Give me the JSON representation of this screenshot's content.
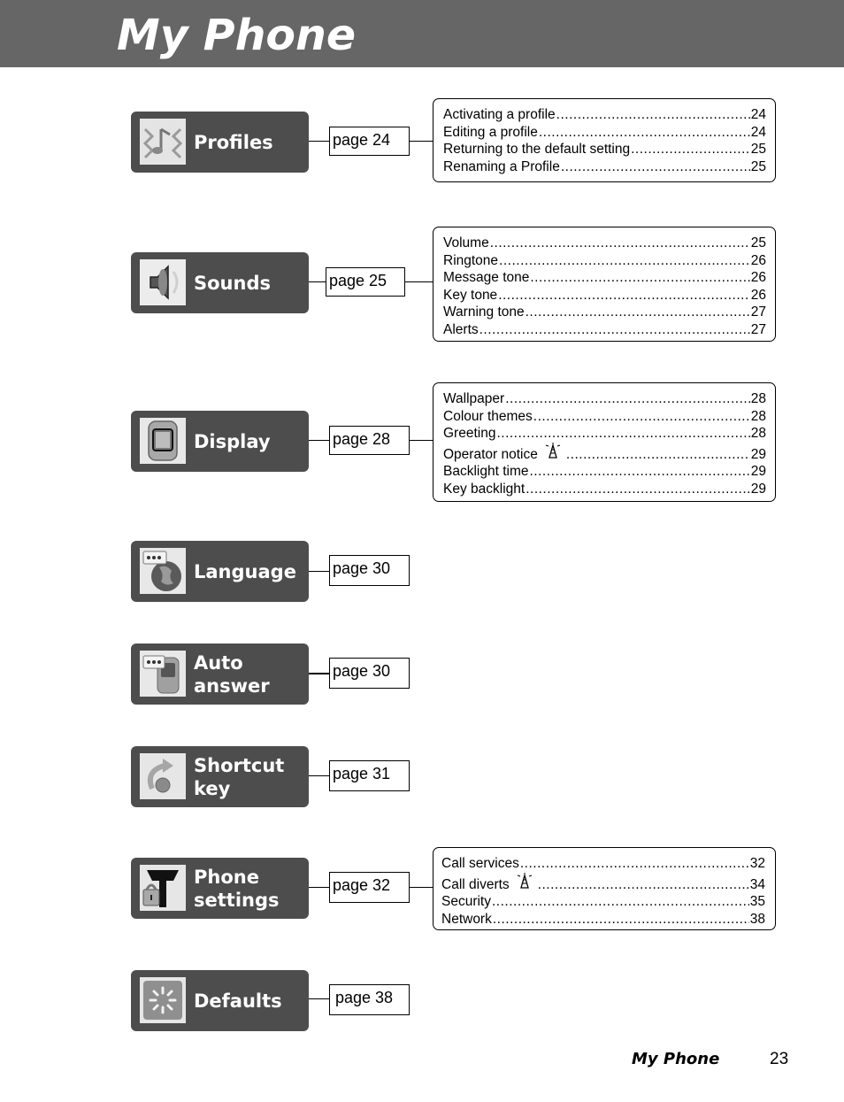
{
  "header": {
    "title": "My Phone"
  },
  "sections": [
    {
      "label": "Profiles",
      "icon": "profiles-icon",
      "page_ref": "page 24",
      "toc": [
        {
          "text": "Activating a profile",
          "page": "24"
        },
        {
          "text": "Editing a profile",
          "page": "24"
        },
        {
          "text": "Returning to the default setting",
          "page": "25"
        },
        {
          "text": "Renaming a Profile",
          "page": "25"
        }
      ]
    },
    {
      "label": "Sounds",
      "icon": "speaker-icon",
      "page_ref": "page 25",
      "toc": [
        {
          "text": "Volume",
          "page": "25"
        },
        {
          "text": "Ringtone",
          "page": "26"
        },
        {
          "text": "Message tone",
          "page": "26"
        },
        {
          "text": "Key tone",
          "page": "26"
        },
        {
          "text": "Warning tone",
          "page": "27"
        },
        {
          "text": "Alerts",
          "page": "27"
        }
      ]
    },
    {
      "label": "Display",
      "icon": "display-icon",
      "page_ref": "page 28",
      "toc": [
        {
          "text": "Wallpaper",
          "page": "28"
        },
        {
          "text": "Colour themes",
          "page": "28"
        },
        {
          "text": "Greeting",
          "page": "28"
        },
        {
          "text": "Operator notice",
          "page": "29",
          "network_dependent": true
        },
        {
          "text": "Backlight time",
          "page": "29"
        },
        {
          "text": "Key backlight",
          "page": "29"
        }
      ]
    },
    {
      "label": "Language",
      "icon": "language-globe-icon",
      "page_ref": "page 30"
    },
    {
      "label": "Auto\nanswer",
      "icon": "auto-answer-icon",
      "page_ref": "page 30"
    },
    {
      "label": "Shortcut\nkey",
      "icon": "shortcut-arrow-icon",
      "page_ref": "page 31"
    },
    {
      "label": "Phone\nsettings",
      "icon": "antenna-lock-icon",
      "page_ref": "page 32",
      "toc": [
        {
          "text": "Call services",
          "page": "32"
        },
        {
          "text": "Call diverts",
          "page": "34",
          "network_dependent": true
        },
        {
          "text": "Security",
          "page": "35"
        },
        {
          "text": "Network",
          "page": "38"
        }
      ]
    },
    {
      "label": "Defaults",
      "icon": "defaults-reset-icon",
      "page_ref": "page 38"
    }
  ],
  "footer": {
    "title": "My Phone",
    "page_number": "23"
  }
}
